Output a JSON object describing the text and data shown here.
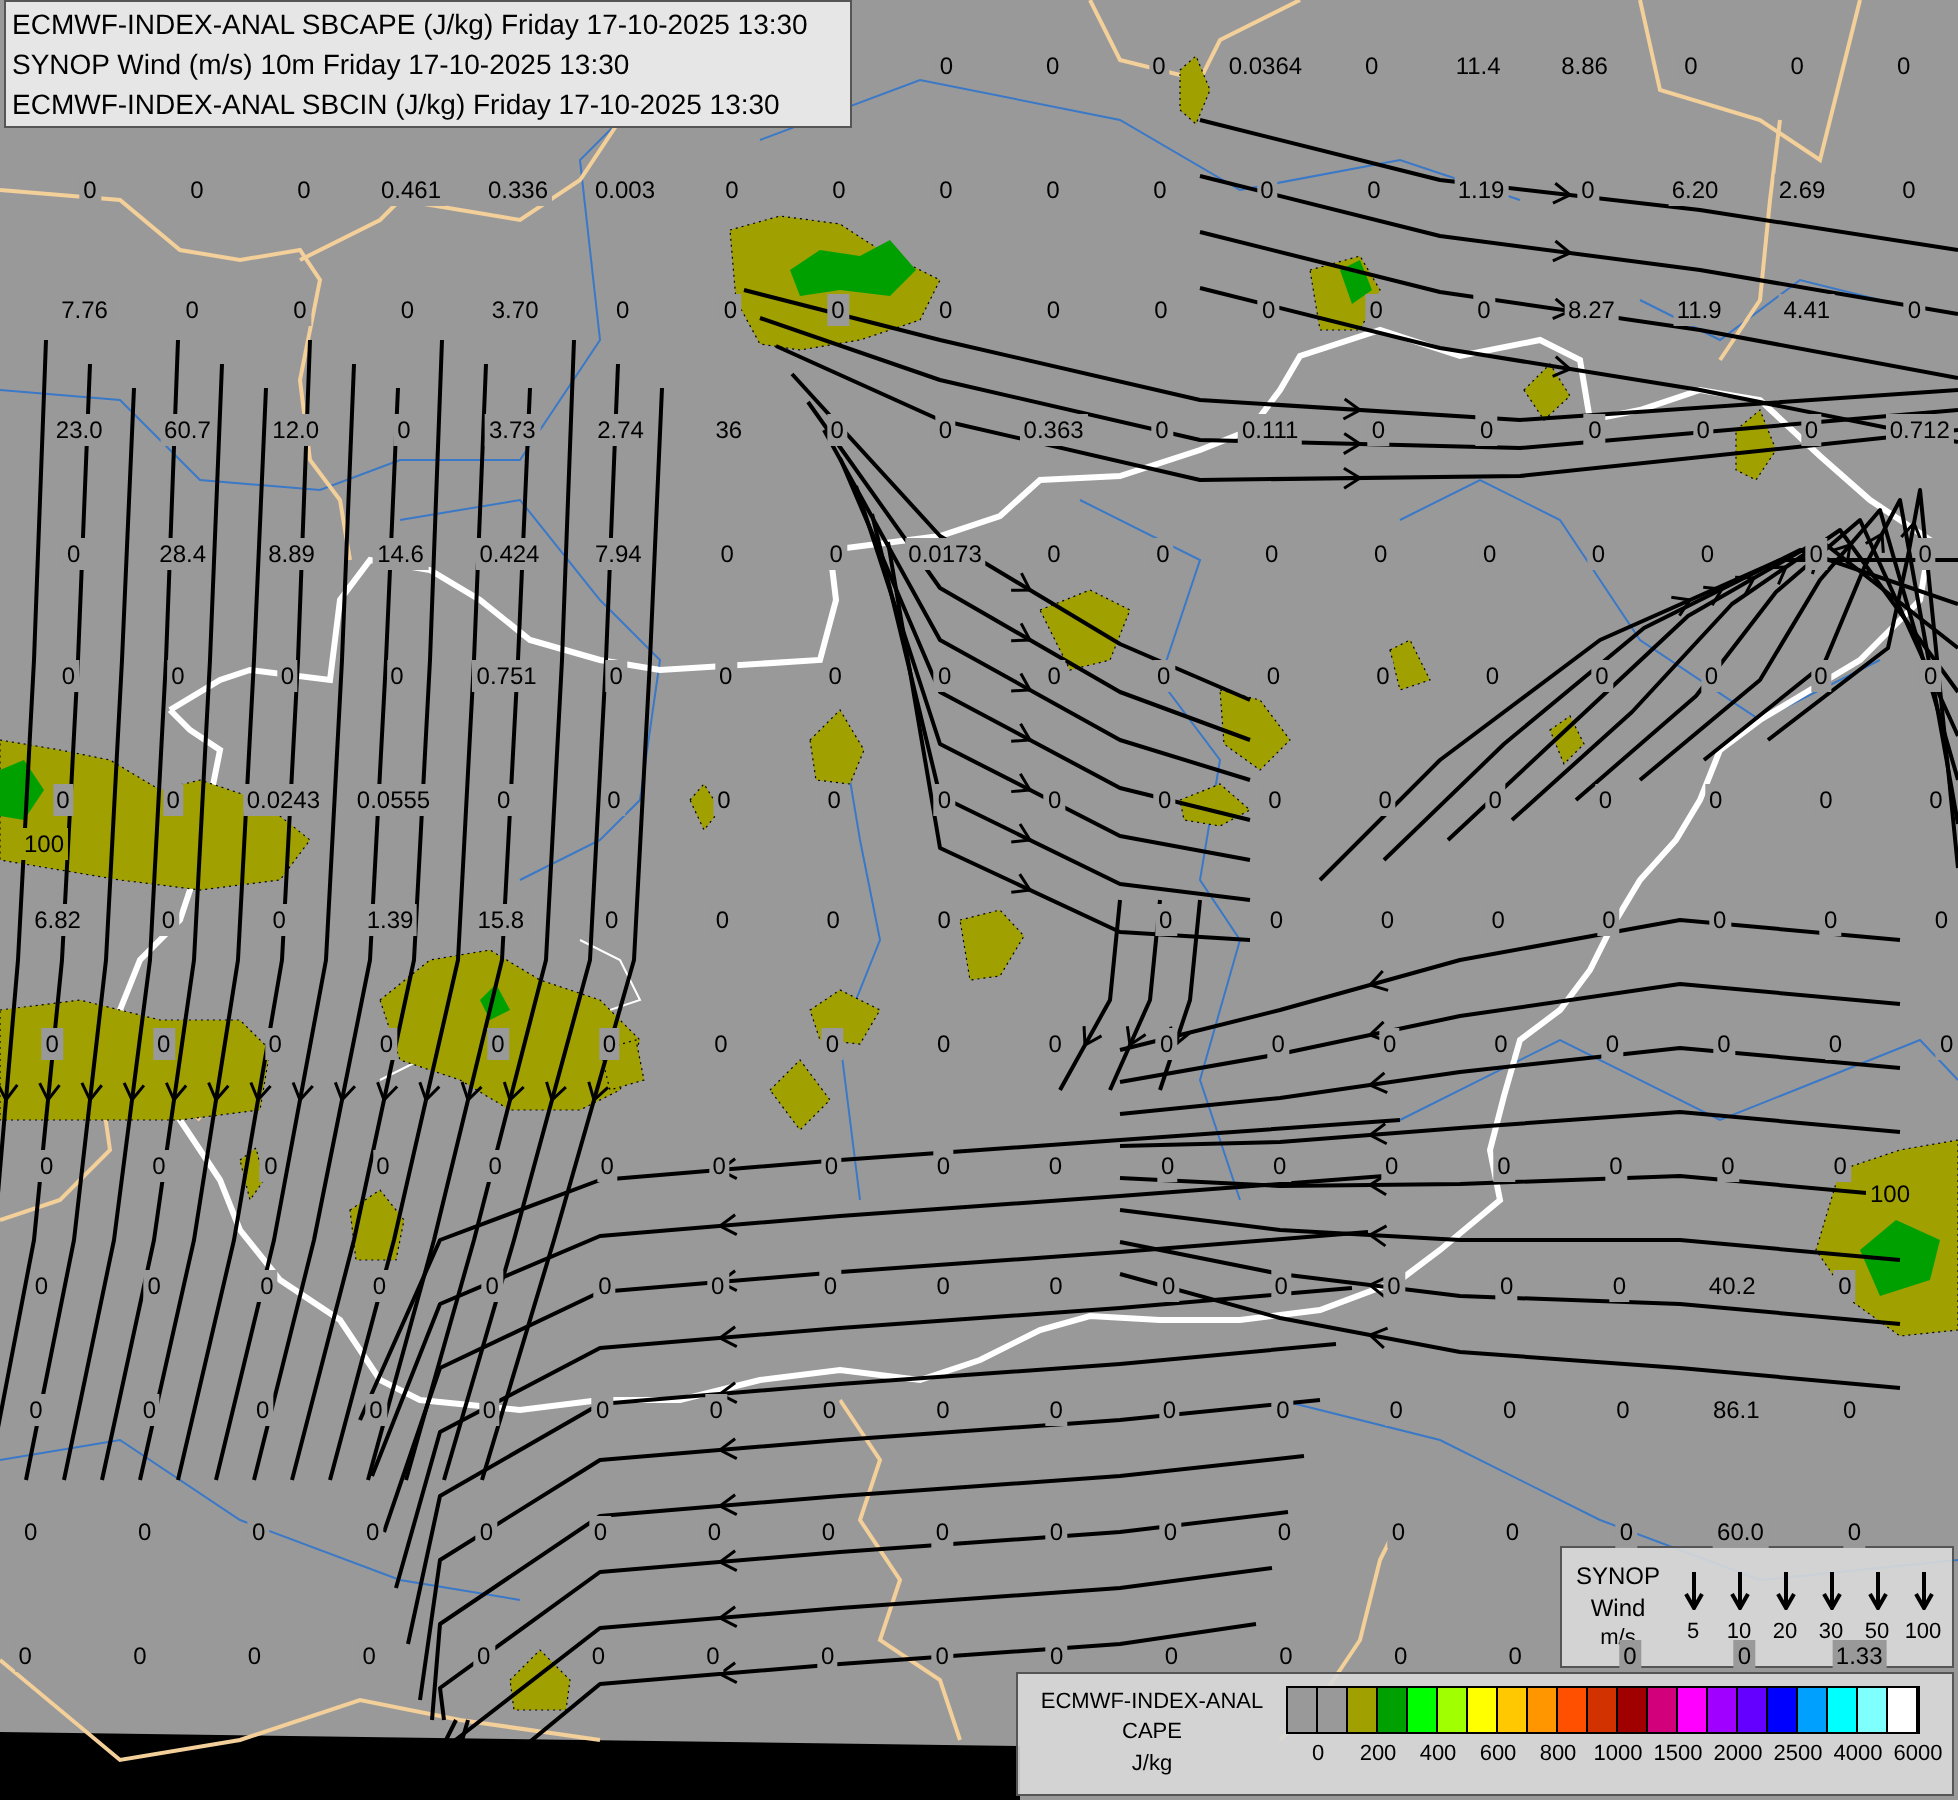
{
  "title_box": {
    "lines": [
      "ECMWF-INDEX-ANAL SBCAPE (J/kg) Friday 17-10-2025 13:30",
      "SYNOP Wind (m/s) 10m Friday 17-10-2025 13:30",
      "ECMWF-INDEX-ANAL SBCIN (J/kg) Friday 17-10-2025 13:30"
    ]
  },
  "sbcin_grid": {
    "rows": [
      [
        null,
        null,
        null,
        null,
        null,
        null,
        null,
        null,
        "0",
        "0",
        "0",
        "0.0364",
        "0",
        "11.4",
        "8.86",
        "0",
        "0",
        "0"
      ],
      [
        "0",
        "0",
        "0",
        "0.461",
        "0.336",
        "0.003",
        "0",
        "0",
        "0",
        "0",
        "0",
        "0",
        "0",
        "1.19",
        "0",
        "6.20",
        "2.69",
        "0"
      ],
      [
        "7.76",
        "0",
        "0",
        "0",
        "3.70",
        "0",
        "0",
        "0",
        "0",
        "0",
        "0",
        "0",
        "0",
        "0",
        "8.27",
        "11.9",
        "4.41",
        "0"
      ],
      [
        "23.0",
        "60.7",
        "12.0",
        "0",
        "3.73",
        "2.74",
        "36",
        "0",
        "0",
        "0.363",
        "0",
        "0.111",
        "0",
        "0",
        "0",
        "0",
        "0",
        "0.712"
      ],
      [
        "0",
        "28.4",
        "8.89",
        "14.6",
        "0.424",
        "7.94",
        "0",
        "0",
        "0.0173",
        "0",
        "0",
        "0",
        "0",
        "0",
        "0",
        "0",
        "0",
        "0"
      ],
      [
        "0",
        "0",
        "0",
        "0",
        "0.751",
        "0",
        "0",
        "0",
        "0",
        "0",
        "0",
        "0",
        "0",
        "0",
        "0",
        "0",
        "0",
        "0"
      ],
      [
        "0",
        "0",
        "0.0243",
        "0.0555",
        "0",
        "0",
        "0",
        "0",
        "0",
        "0",
        "0",
        "0",
        "0",
        "0",
        "0",
        "0",
        "0",
        "0"
      ],
      [
        "6.82",
        "0",
        "0",
        "1.39",
        "15.8",
        "0",
        "0",
        "0",
        "0",
        null,
        "0",
        "0",
        "0",
        "0",
        "0",
        "0",
        "0",
        "0"
      ],
      [
        "0",
        "0",
        "0",
        "0",
        "0",
        "0",
        "0",
        "0",
        "0",
        "0",
        "0",
        "0",
        "0",
        "0",
        "0",
        "0",
        "0",
        "0"
      ],
      [
        "0",
        "0",
        "0",
        "0",
        "0",
        "0",
        "0",
        "0",
        "0",
        "0",
        "0",
        "0",
        "0",
        "0",
        "0",
        "0",
        "0",
        null
      ],
      [
        "0",
        "0",
        "0",
        "0",
        "0",
        "0",
        "0",
        "0",
        "0",
        "0",
        "0",
        "0",
        "0",
        "0",
        "0",
        "40.2",
        "0",
        null
      ],
      [
        "0",
        "0",
        "0",
        "0",
        "0",
        "0",
        "0",
        "0",
        "0",
        "0",
        "0",
        "0",
        "0",
        "0",
        "0",
        "86.1",
        "0",
        null
      ],
      [
        "0",
        "0",
        "0",
        "0",
        "0",
        "0",
        "0",
        "0",
        "0",
        "0",
        "0",
        "0",
        "0",
        "0",
        "0",
        "60.0",
        "0",
        null
      ],
      [
        "0",
        "0",
        "0",
        "0",
        "0",
        "0",
        "0",
        "0",
        "0",
        "0",
        "0",
        "0",
        "0",
        "0",
        "0",
        "0",
        "1.33",
        null
      ]
    ]
  },
  "cape_contour_labels": [
    "100",
    "100"
  ],
  "wind_legend": {
    "title_lines": [
      "SYNOP",
      "Wind",
      "m/s"
    ],
    "speeds": [
      "5",
      "10",
      "20",
      "30",
      "50",
      "100"
    ]
  },
  "cape_legend": {
    "title_lines": [
      "ECMWF-INDEX-ANAL",
      "CAPE"
    ],
    "unit": "J/kg",
    "swatches": [
      {
        "color": "#999999"
      },
      {
        "color": "#999999"
      },
      {
        "color": "#a0a000"
      },
      {
        "color": "#00a000"
      },
      {
        "color": "#00ff00"
      },
      {
        "color": "#a0ff00"
      },
      {
        "color": "#ffff00"
      },
      {
        "color": "#ffc800"
      },
      {
        "color": "#ff9600"
      },
      {
        "color": "#ff5000"
      },
      {
        "color": "#d23200"
      },
      {
        "color": "#a00000"
      },
      {
        "color": "#d2007a"
      },
      {
        "color": "#ff00ff"
      },
      {
        "color": "#a000ff"
      },
      {
        "color": "#6400ff"
      },
      {
        "color": "#0000ff"
      },
      {
        "color": "#00a0ff"
      },
      {
        "color": "#00ffff"
      },
      {
        "color": "#80ffff"
      },
      {
        "color": "#ffffff"
      }
    ],
    "ticks": [
      "0",
      "200",
      "400",
      "600",
      "800",
      "1000",
      "1500",
      "2000",
      "2500",
      "4000",
      "6000"
    ]
  }
}
